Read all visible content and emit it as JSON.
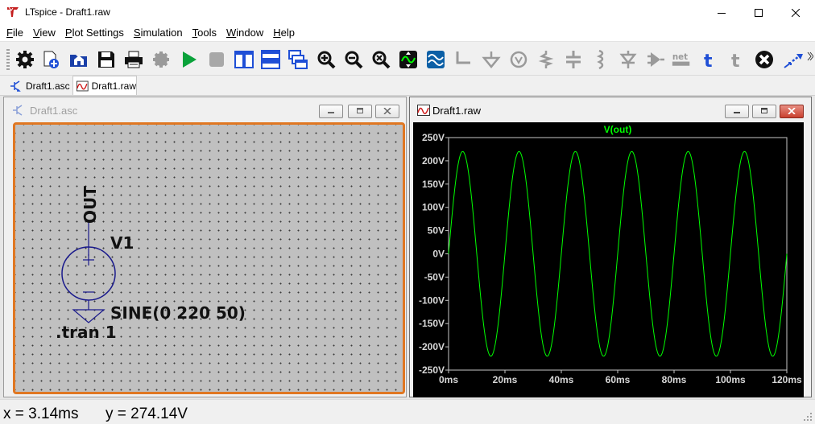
{
  "window": {
    "title": "LTspice - Draft1.raw"
  },
  "menu": [
    "File",
    "View",
    "Plot Settings",
    "Simulation",
    "Tools",
    "Window",
    "Help"
  ],
  "toolbar": {
    "buttons": [
      "settings-icon",
      "new-schematic-icon",
      "open-icon",
      "save-icon",
      "print-icon",
      "halt-icon",
      "run-icon",
      "stop-icon",
      "tile-vertical-icon",
      "tile-horizontal-icon",
      "cascade-icon",
      "zoom-in-icon",
      "zoom-out-icon",
      "zoom-fit-icon",
      "autoscale-icon",
      "add-trace-icon",
      "wire-icon",
      "ground-icon",
      "voltage-source-icon",
      "resistor-icon",
      "capacitor-icon",
      "inductor-icon",
      "diode-icon",
      "component-icon",
      "netlabel-icon",
      "text-icon",
      "spice-directive-icon",
      "delete-icon",
      "move-icon"
    ],
    "netlabel_text": "net",
    "text_glyph": "t"
  },
  "tabs": [
    {
      "label": "Draft1.asc",
      "icon": "schematic-icon",
      "active": false
    },
    {
      "label": "Draft1.raw",
      "icon": "waveform-icon",
      "active": true
    }
  ],
  "schematic_window": {
    "title": "Draft1.asc",
    "net_label": "OUT",
    "component_name": "V1",
    "component_value": "SINE(0 220 50)",
    "directive": ".tran 1"
  },
  "plot_window": {
    "title": "Draft1.raw"
  },
  "chart_data": {
    "type": "line",
    "title": "V(out)",
    "x_ticks": [
      "0ms",
      "20ms",
      "40ms",
      "60ms",
      "80ms",
      "100ms",
      "120ms"
    ],
    "y_ticks": [
      "250V",
      "200V",
      "150V",
      "100V",
      "50V",
      "0V",
      "-50V",
      "-100V",
      "-150V",
      "-200V",
      "-250V"
    ],
    "xlim": [
      0,
      120
    ],
    "ylim": [
      -250,
      250
    ],
    "grid": false,
    "series": [
      {
        "name": "V(out)",
        "color": "#00ff00",
        "function": "220*sin(2*pi*50*t)",
        "amplitude": 220,
        "frequency_hz": 50,
        "x_unit": "ms",
        "y_unit": "V"
      }
    ]
  },
  "status": {
    "x_label": "x = 3.14ms",
    "y_label": "y = 274.14V"
  },
  "colors": {
    "schematic_bg": "#c0c0c0",
    "schematic_border": "#e07722",
    "trace": "#00ff00",
    "plot_bg": "#000000",
    "component": "#1a1a8c"
  }
}
